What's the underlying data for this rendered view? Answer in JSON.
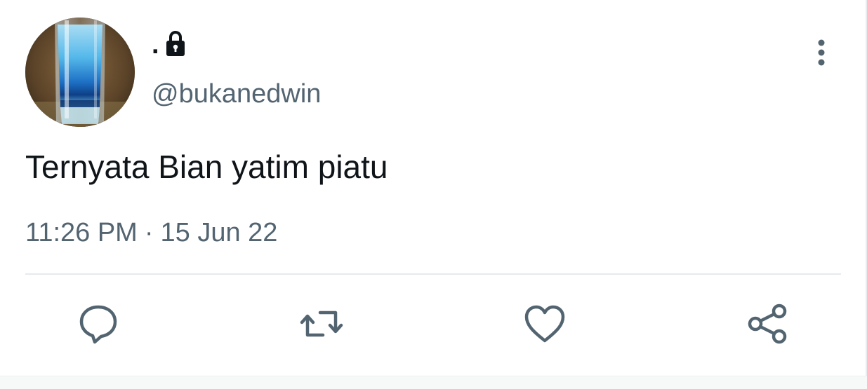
{
  "tweet": {
    "display_name": ".",
    "handle": "@bukanedwin",
    "text": "Ternyata Bian yatim piatu",
    "time": "11:26 PM",
    "separator": "·",
    "date": "15 Jun 22",
    "protected_icon": "lock-icon",
    "more_icon": "more-vertical-icon",
    "avatar": "avatar-image"
  },
  "actions": [
    {
      "name": "reply",
      "icon": "reply-icon"
    },
    {
      "name": "retweet",
      "icon": "retweet-icon"
    },
    {
      "name": "like",
      "icon": "heart-icon"
    },
    {
      "name": "share",
      "icon": "share-icon"
    }
  ],
  "colors": {
    "text_primary": "#0f1419",
    "text_secondary": "#536471",
    "icon": "#536471",
    "divider": "#e7eaec",
    "background": "#ffffff"
  }
}
